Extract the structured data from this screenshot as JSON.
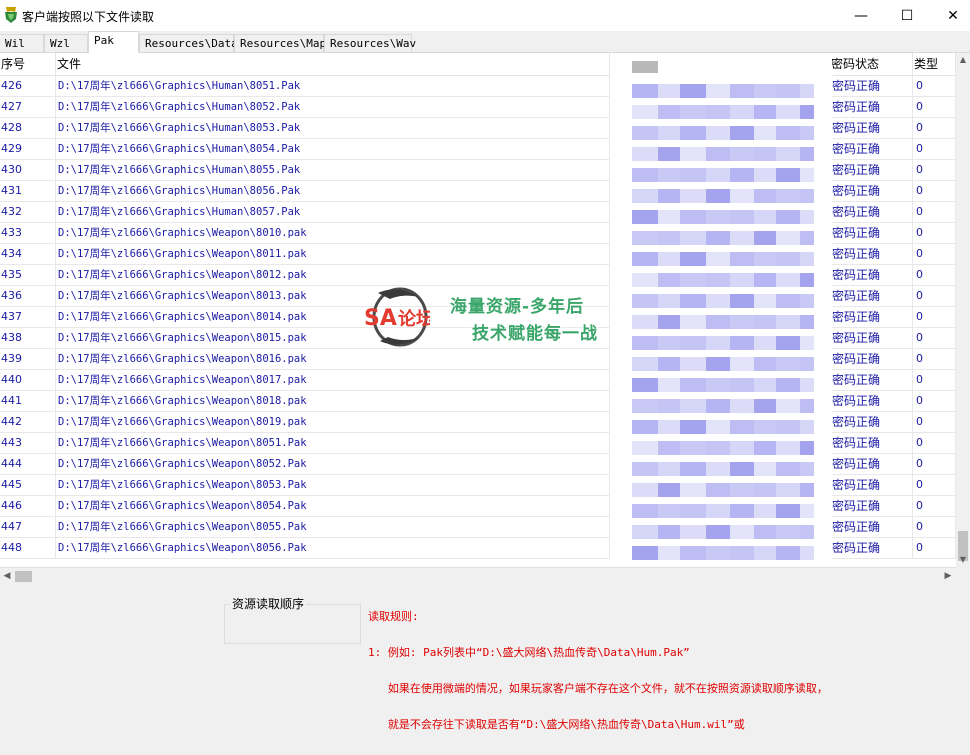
{
  "window": {
    "title": "客户端按照以下文件读取",
    "minimize": "—",
    "maximize": "☐",
    "close": "✕",
    "app_icon": "app-icon"
  },
  "tabs": [
    "Wil",
    "Wzl",
    "Pak",
    "Resources\\Data",
    "Resources\\Map",
    "Resources\\Wav"
  ],
  "active_tab": "Pak",
  "columns": {
    "index": "序号",
    "file": "文件",
    "password_status": "密码状态",
    "type": "类型"
  },
  "rows": [
    {
      "index": "426",
      "file": "D:\\17周年\\zl666\\Graphics\\Human\\8051.Pak",
      "status": "密码正确",
      "type": "0"
    },
    {
      "index": "427",
      "file": "D:\\17周年\\zl666\\Graphics\\Human\\8052.Pak",
      "status": "密码正确",
      "type": "0"
    },
    {
      "index": "428",
      "file": "D:\\17周年\\zl666\\Graphics\\Human\\8053.Pak",
      "status": "密码正确",
      "type": "0"
    },
    {
      "index": "429",
      "file": "D:\\17周年\\zl666\\Graphics\\Human\\8054.Pak",
      "status": "密码正确",
      "type": "0"
    },
    {
      "index": "430",
      "file": "D:\\17周年\\zl666\\Graphics\\Human\\8055.Pak",
      "status": "密码正确",
      "type": "0"
    },
    {
      "index": "431",
      "file": "D:\\17周年\\zl666\\Graphics\\Human\\8056.Pak",
      "status": "密码正确",
      "type": "0"
    },
    {
      "index": "432",
      "file": "D:\\17周年\\zl666\\Graphics\\Human\\8057.Pak",
      "status": "密码正确",
      "type": "0"
    },
    {
      "index": "433",
      "file": "D:\\17周年\\zl666\\Graphics\\Weapon\\8010.pak",
      "status": "密码正确",
      "type": "0"
    },
    {
      "index": "434",
      "file": "D:\\17周年\\zl666\\Graphics\\Weapon\\8011.pak",
      "status": "密码正确",
      "type": "0"
    },
    {
      "index": "435",
      "file": "D:\\17周年\\zl666\\Graphics\\Weapon\\8012.pak",
      "status": "密码正确",
      "type": "0"
    },
    {
      "index": "436",
      "file": "D:\\17周年\\zl666\\Graphics\\Weapon\\8013.pak",
      "status": "密码正确",
      "type": "0"
    },
    {
      "index": "437",
      "file": "D:\\17周年\\zl666\\Graphics\\Weapon\\8014.pak",
      "status": "密码正确",
      "type": "0"
    },
    {
      "index": "438",
      "file": "D:\\17周年\\zl666\\Graphics\\Weapon\\8015.pak",
      "status": "密码正确",
      "type": "0"
    },
    {
      "index": "439",
      "file": "D:\\17周年\\zl666\\Graphics\\Weapon\\8016.pak",
      "status": "密码正确",
      "type": "0"
    },
    {
      "index": "440",
      "file": "D:\\17周年\\zl666\\Graphics\\Weapon\\8017.pak",
      "status": "密码正确",
      "type": "0"
    },
    {
      "index": "441",
      "file": "D:\\17周年\\zl666\\Graphics\\Weapon\\8018.pak",
      "status": "密码正确",
      "type": "0"
    },
    {
      "index": "442",
      "file": "D:\\17周年\\zl666\\Graphics\\Weapon\\8019.pak",
      "status": "密码正确",
      "type": "0"
    },
    {
      "index": "443",
      "file": "D:\\17周年\\zl666\\Graphics\\Weapon\\8051.Pak",
      "status": "密码正确",
      "type": "0"
    },
    {
      "index": "444",
      "file": "D:\\17周年\\zl666\\Graphics\\Weapon\\8052.Pak",
      "status": "密码正确",
      "type": "0"
    },
    {
      "index": "445",
      "file": "D:\\17周年\\zl666\\Graphics\\Weapon\\8053.Pak",
      "status": "密码正确",
      "type": "0"
    },
    {
      "index": "446",
      "file": "D:\\17周年\\zl666\\Graphics\\Weapon\\8054.Pak",
      "status": "密码正确",
      "type": "0"
    },
    {
      "index": "447",
      "file": "D:\\17周年\\zl666\\Graphics\\Weapon\\8055.Pak",
      "status": "密码正确",
      "type": "0"
    },
    {
      "index": "448",
      "file": "D:\\17周年\\zl666\\Graphics\\Weapon\\8056.Pak",
      "status": "密码正确",
      "type": "0"
    }
  ],
  "bottom": {
    "group_title": "资源读取顺序",
    "rules_lines": [
      "读取规则:",
      "1: 例如: Pak列表中“D:\\盛大网络\\热血传奇\\Data\\Hum.Pak”",
      "   如果在使用微端的情况，如果玩家客户端不存在这个文件，就不在按照资源读取顺序读取，",
      "   就是不会存往下读取是否有“D:\\盛大网络\\热血传奇\\Data\\Hum.wil”或"
    ]
  },
  "watermark": {
    "logo_text": "SA论坛",
    "line1": "海量资源-多年后",
    "line2": "技术赋能每一战"
  },
  "colors": {
    "row_text": "#1a1aa6",
    "rules_text": "#e00000",
    "watermark_text": "#3aa66a",
    "blur_tint": "#8f8ff0"
  }
}
